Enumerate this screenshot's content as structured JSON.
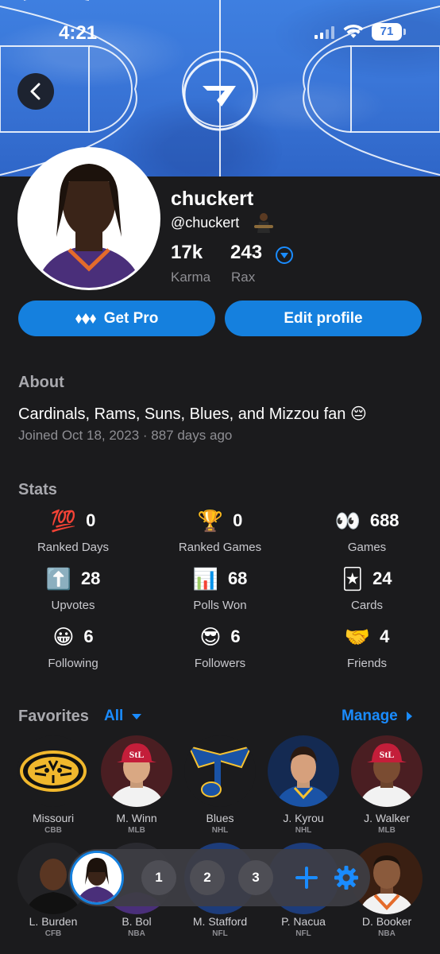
{
  "status": {
    "time": "4:21",
    "battery": "71"
  },
  "profile": {
    "username": "chuckert",
    "handle": "@chuckert",
    "karma_value": "17k",
    "karma_label": "Karma",
    "rax_value": "243",
    "rax_label": "Rax"
  },
  "buttons": {
    "get_pro": "Get Pro",
    "edit_profile": "Edit profile"
  },
  "about": {
    "title": "About",
    "text": "Cardinals, Rams, Suns, Blues, and Mizzou fan 😔",
    "joined": "Joined Oct 18, 2023 · 887 days ago"
  },
  "stats": {
    "title": "Stats",
    "items": [
      {
        "icon": "💯",
        "value": "0",
        "label": "Ranked Days"
      },
      {
        "icon": "🏆",
        "value": "0",
        "label": "Ranked Games"
      },
      {
        "icon": "👀",
        "value": "688",
        "label": "Games"
      },
      {
        "icon": "⬆️",
        "value": "28",
        "label": "Upvotes"
      },
      {
        "icon": "📊",
        "value": "68",
        "label": "Polls Won"
      },
      {
        "icon": "🃏",
        "value": "24",
        "label": "Cards"
      },
      {
        "icon": "😀",
        "value": "6",
        "label": "Following"
      },
      {
        "icon": "😎",
        "value": "6",
        "label": "Followers"
      },
      {
        "icon": "🤝",
        "value": "4",
        "label": "Friends"
      }
    ]
  },
  "favorites": {
    "title": "Favorites",
    "filter": "All",
    "manage": "Manage",
    "items": [
      {
        "name": "Missouri",
        "league": "CBB"
      },
      {
        "name": "M. Winn",
        "league": "MLB"
      },
      {
        "name": "Blues",
        "league": "NHL"
      },
      {
        "name": "J. Kyrou",
        "league": "NHL"
      },
      {
        "name": "J. Walker",
        "league": "MLB"
      },
      {
        "name": "L. Burden",
        "league": "CFB"
      },
      {
        "name": "B. Bol",
        "league": "NBA"
      },
      {
        "name": "M. Stafford",
        "league": "NFL"
      },
      {
        "name": "P. Nacua",
        "league": "NFL"
      },
      {
        "name": "D. Booker",
        "league": "NBA"
      }
    ]
  },
  "floatbar": {
    "slot1": "1",
    "slot2": "2",
    "slot3": "3"
  },
  "colors": {
    "accent": "#1580de",
    "link": "#1a8cff",
    "background": "#1b1b1d",
    "banner": "#3a76d8"
  }
}
